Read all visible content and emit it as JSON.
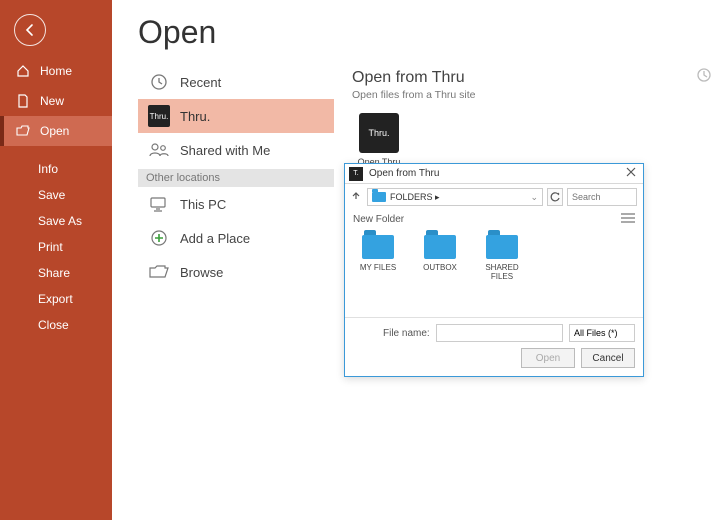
{
  "colors": {
    "accent": "#b7472a",
    "dialog_border": "#3b99d8",
    "folder": "#34a2e0"
  },
  "sidebar": {
    "items": [
      {
        "label": "Home",
        "icon": "home"
      },
      {
        "label": "New",
        "icon": "file"
      },
      {
        "label": "Open",
        "icon": "folder-open",
        "selected": true
      }
    ],
    "subitems": [
      {
        "label": "Info"
      },
      {
        "label": "Save"
      },
      {
        "label": "Save As"
      },
      {
        "label": "Print"
      },
      {
        "label": "Share"
      },
      {
        "label": "Export"
      },
      {
        "label": "Close"
      }
    ]
  },
  "page": {
    "title": "Open"
  },
  "locations": {
    "primary": [
      {
        "label": "Recent",
        "icon": "clock"
      },
      {
        "label": "Thru.",
        "icon": "thru",
        "selected": true
      },
      {
        "label": "Shared with Me",
        "icon": "shared"
      }
    ],
    "divider": "Other locations",
    "other": [
      {
        "label": "This PC",
        "icon": "pc"
      },
      {
        "label": "Add a Place",
        "icon": "add-place"
      },
      {
        "label": "Browse",
        "icon": "folder-open"
      }
    ]
  },
  "right": {
    "title": "Open from Thru",
    "subtitle": "Open files from a Thru site",
    "tile_label": "Open Thru"
  },
  "dialog": {
    "title": "Open from Thru",
    "breadcrumb": "FOLDERS ▸",
    "search_placeholder": "Search",
    "toolbar_label": "New Folder",
    "files": [
      {
        "name": "MY FILES"
      },
      {
        "name": "OUTBOX"
      },
      {
        "name": "SHARED FILES"
      }
    ],
    "filename_label": "File name:",
    "filename_value": "",
    "filter": "All Files (*)",
    "open_btn": "Open",
    "cancel_btn": "Cancel"
  }
}
